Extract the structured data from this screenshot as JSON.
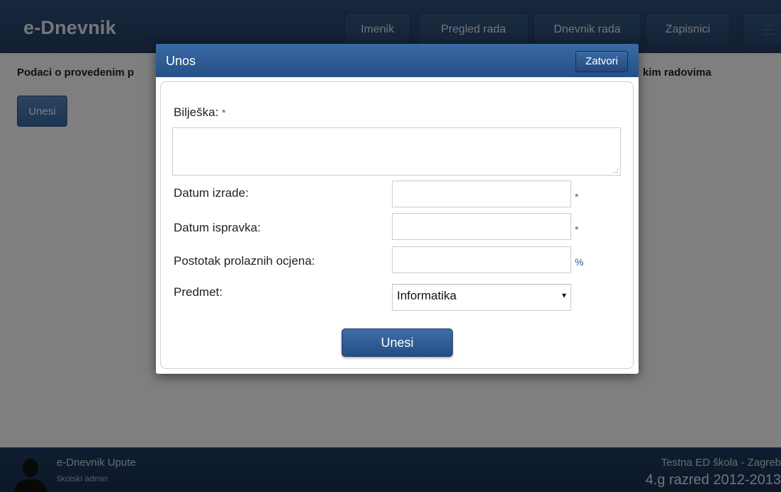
{
  "app": {
    "logo": "e-Dnevnik"
  },
  "nav": {
    "items": [
      {
        "label": "Imenik"
      },
      {
        "label": "Pregled rada"
      },
      {
        "label": "Dnevnik rada"
      },
      {
        "label": "Zapisnici"
      }
    ]
  },
  "page": {
    "title_left": "Podaci o provedenim p",
    "title_right": "kim radovima",
    "button_label": "Unesi"
  },
  "footer": {
    "title": "e-Dnevnik Upute",
    "subtitle": "školski admin",
    "school": "Testna ED škola - Zagreb",
    "class": "4.g razred 2012-2013"
  },
  "modal": {
    "title": "Unos",
    "close_label": "Zatvori",
    "fields": {
      "biljeska_label": "Bilješka:",
      "datum_izrade_label": "Datum izrade:",
      "datum_ispravka_label": "Datum ispravka:",
      "postotak_label": "Postotak prolaznih ocjena:",
      "predmet_label": "Predmet:",
      "required_mark": "*",
      "percent_unit": "%",
      "predmet_value": "Informatika"
    },
    "submit_label": "Unesi"
  },
  "colors": {
    "header_bg": "#2d4d78",
    "accent": "#2d5a97",
    "footer_bg": "#1b3558"
  }
}
